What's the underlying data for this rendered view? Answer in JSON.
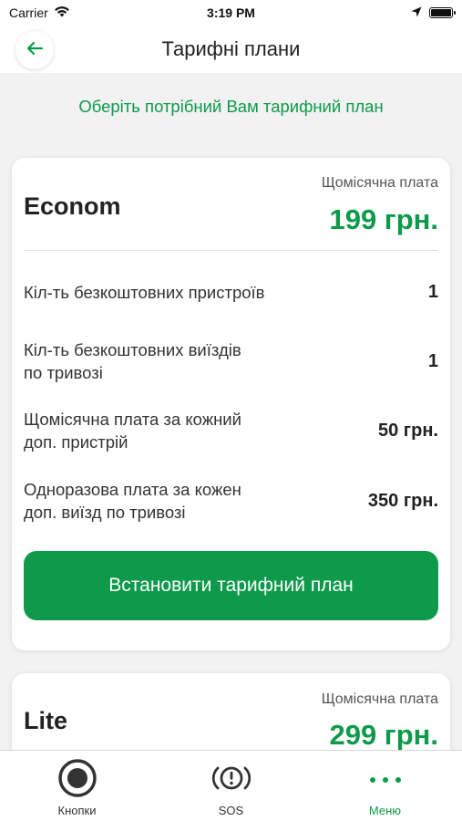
{
  "status_bar": {
    "carrier": "Carrier",
    "time": "3:19 PM"
  },
  "header": {
    "title": "Тарифні плани"
  },
  "subtitle": "Оберіть потрібний Вам тарифний план",
  "plans": [
    {
      "name": "Econom",
      "fee_label": "Щомісячна плата",
      "fee_value": "199 грн.",
      "rows": [
        {
          "label": "Кіл-ть безкоштовних пристроїв",
          "value": "1"
        },
        {
          "label": "Кіл-ть безкоштовних виїздів\nпо тривозі",
          "value": "1"
        },
        {
          "label": "Щомісячна плата за кожний\nдоп. пристрій",
          "value": "50 грн."
        },
        {
          "label": "Одноразова плата за кожен\nдоп. виїзд по тривозі",
          "value": "350 грн."
        }
      ],
      "button_label": "Встановити тарифний план"
    },
    {
      "name": "Lite",
      "fee_label": "Щомісячна плата",
      "fee_value": "299 грн."
    }
  ],
  "tabs": [
    {
      "label": "Кнопки",
      "icon": "record-button-icon",
      "active": false
    },
    {
      "label": "SOS",
      "icon": "sos-alert-icon",
      "active": false
    },
    {
      "label": "Меню",
      "icon": "more-dots-icon",
      "active": true
    }
  ],
  "colors": {
    "accent": "#0e9a4b",
    "background": "#f2f2f3",
    "card": "#ffffff"
  }
}
